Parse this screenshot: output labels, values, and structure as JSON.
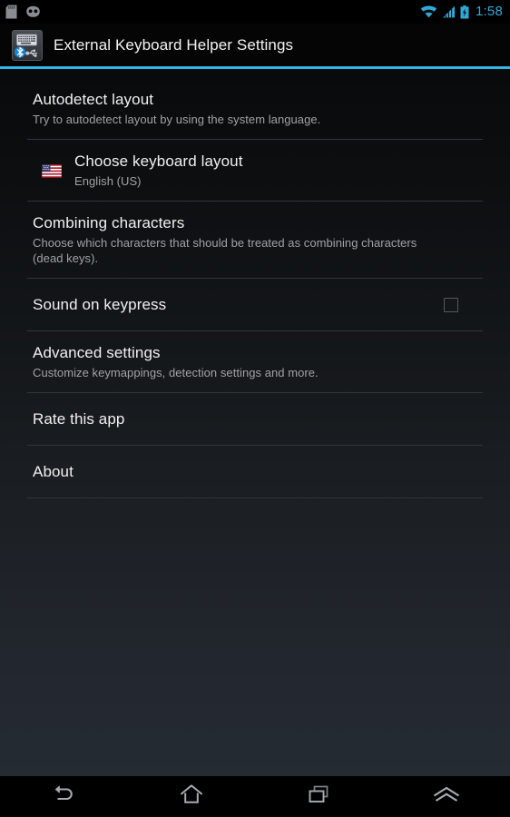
{
  "status_bar": {
    "left_icons": [
      "sd-card-icon",
      "cyanogenmod-head-icon"
    ],
    "right_icons": [
      "wifi-icon",
      "signal-bars-icon",
      "battery-charging-icon"
    ],
    "time": "1:58",
    "accent_color": "#33b5e5"
  },
  "action_bar": {
    "app_icon": "external-keyboard-helper-icon",
    "title": "External Keyboard Helper Settings"
  },
  "preferences": [
    {
      "name": "autodetect-layout",
      "title": "Autodetect layout",
      "summary": "Try to autodetect layout by using the system language."
    },
    {
      "name": "choose-keyboard-layout",
      "title": "Choose keyboard layout",
      "summary": "English (US)",
      "icon": "us-flag-icon"
    },
    {
      "name": "combining-characters",
      "title": "Combining characters",
      "summary": "Choose which characters that should be treated as combining characters (dead keys)."
    },
    {
      "name": "sound-on-keypress",
      "title": "Sound on keypress",
      "summary": "",
      "checkbox": "unchecked"
    },
    {
      "name": "advanced-settings",
      "title": "Advanced settings",
      "summary": "Customize keymappings, detection settings and more."
    },
    {
      "name": "rate-this-app",
      "title": "Rate this app",
      "summary": ""
    },
    {
      "name": "about",
      "title": "About",
      "summary": ""
    }
  ],
  "nav_bar": {
    "buttons": [
      {
        "name": "back-button",
        "icon": "back-arrow-icon"
      },
      {
        "name": "home-button",
        "icon": "home-icon"
      },
      {
        "name": "recents-button",
        "icon": "recent-apps-icon"
      },
      {
        "name": "menu-button",
        "icon": "chevron-up-double-icon"
      }
    ]
  }
}
